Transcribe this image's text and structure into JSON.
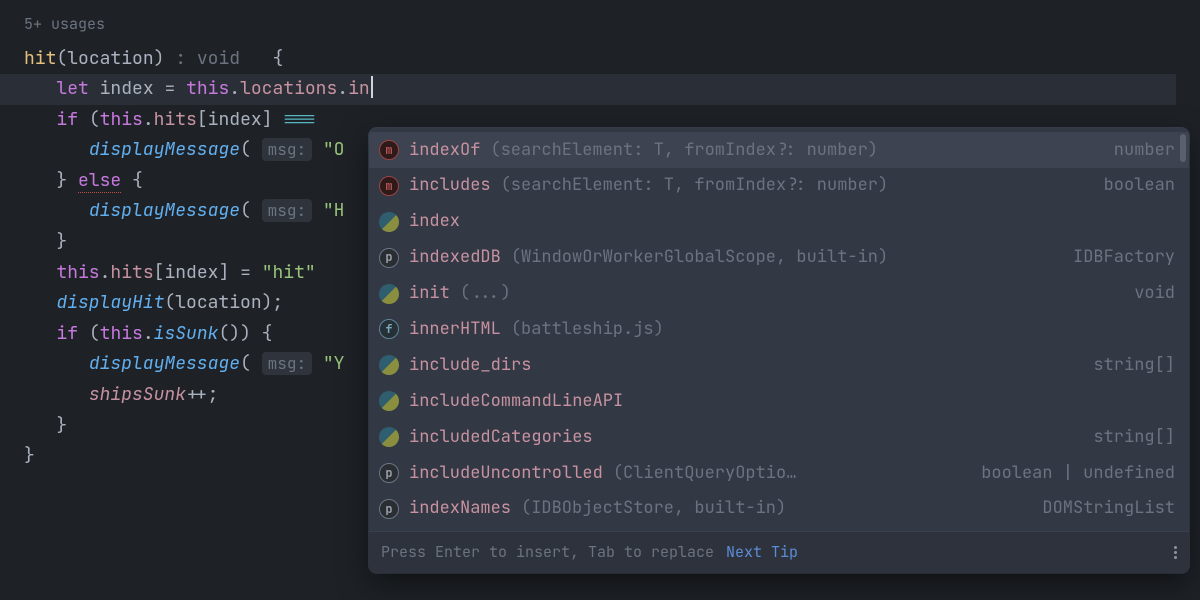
{
  "usages_hint": "5+ usages",
  "code": {
    "fn_name": "hit",
    "param": "location",
    "ret_hint": ": void",
    "let_kw": "let",
    "index_var": "index",
    "eq": "=",
    "this_kw": "this",
    "locations_prop": "locations",
    "typed_partial": "in",
    "if_kw": "if",
    "hits_prop": "hits",
    "index_ref": "index",
    "triple_eq": "===",
    "displayMessage": "displayMessage",
    "msg_hint": "msg:",
    "oops_str": "\"O",
    "else_kw": "else",
    "close_brace": "}",
    "hit_str_partial": "\"H",
    "hit_str_full": "\"hit\"",
    "displayHit": "displayHit",
    "isSunk": "isSunk",
    "y_str": "\"Y",
    "shipsSunk": "shipsSunk",
    "pp": "++"
  },
  "completions": [
    {
      "icon": "m",
      "name": "indexOf",
      "sig": "(searchElement: T, fromIndex?: number)",
      "ret": "number",
      "selected": true
    },
    {
      "icon": "m",
      "name": "includes",
      "sig": "(searchElement: T, fromIndex?: number)",
      "ret": "boolean"
    },
    {
      "icon": "js",
      "name": "index",
      "sig": "",
      "ret": ""
    },
    {
      "icon": "p",
      "name": "indexedDB",
      "sig": " (WindowOrWorkerGlobalScope, built-in)",
      "ret": "IDBFactory"
    },
    {
      "icon": "js",
      "name": "init",
      "sig": "(...)",
      "ret": "void"
    },
    {
      "icon": "f",
      "name": "innerHTML",
      "sig": " (battleship.js)",
      "ret": ""
    },
    {
      "icon": "js",
      "name": "include_dirs",
      "sig": "",
      "ret": "string[]"
    },
    {
      "icon": "js",
      "name": "includeCommandLineAPI",
      "sig": "",
      "ret": ""
    },
    {
      "icon": "js",
      "name": "includedCategories",
      "sig": "",
      "ret": "string[]"
    },
    {
      "icon": "p",
      "name": "includeUncontrolled",
      "sig": " (ClientQueryOptio…",
      "ret": "boolean | undefined"
    },
    {
      "icon": "p",
      "name": "indexNames",
      "sig": " (IDBObjectStore, built-in)",
      "ret": "DOMStringList"
    }
  ],
  "footer": {
    "hint": "Press Enter to insert, Tab to replace",
    "link": "Next Tip"
  }
}
